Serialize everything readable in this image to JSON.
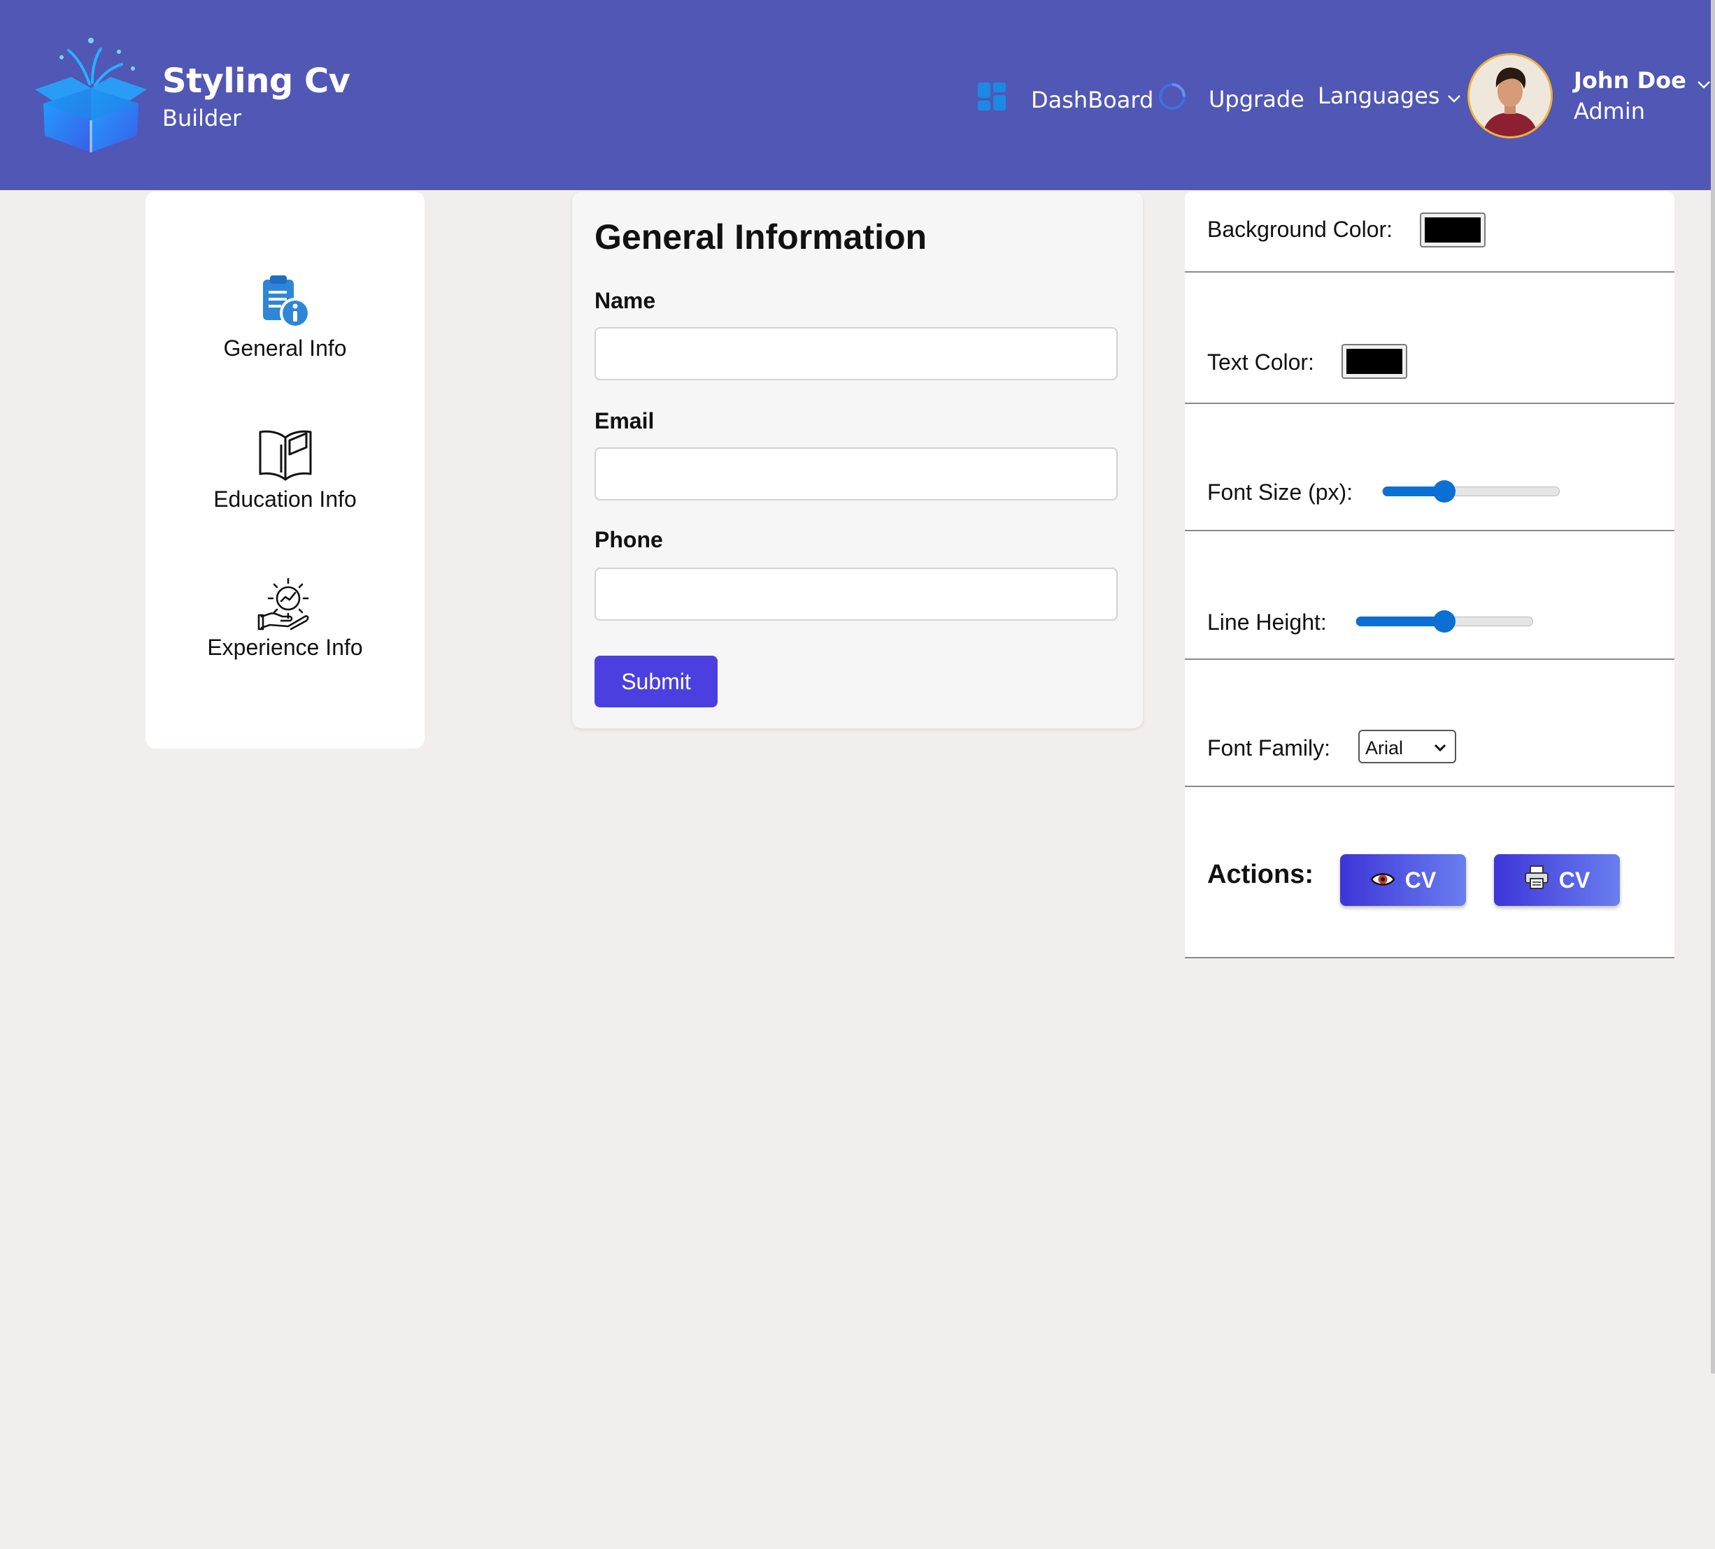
{
  "header": {
    "brand_title": "Styling Cv",
    "brand_subtitle": "Builder",
    "nav": {
      "dashboard_label": "DashBoard",
      "upgrade_label": "Upgrade",
      "languages_label": "Languages"
    },
    "user": {
      "name": "John Doe",
      "role": "Admin"
    }
  },
  "sidebar": {
    "items": [
      {
        "label": "General Info",
        "icon": "clipboard-info-icon"
      },
      {
        "label": "Education Info",
        "icon": "open-book-icon"
      },
      {
        "label": "Experience Info",
        "icon": "gear-hand-icon"
      }
    ]
  },
  "form": {
    "title": "General Information",
    "fields": [
      {
        "label": "Name",
        "value": ""
      },
      {
        "label": "Email",
        "value": ""
      },
      {
        "label": "Phone",
        "value": ""
      }
    ],
    "submit_label": "Submit"
  },
  "style_panel": {
    "background_color_label": "Background Color:",
    "background_color_value": "#000000",
    "text_color_label": "Text Color:",
    "text_color_value": "#000000",
    "font_size_label": "Font Size (px):",
    "font_size_slider_fraction": 0.35,
    "line_height_label": "Line Height:",
    "line_height_slider_fraction": 0.5,
    "font_family_label": "Font Family:",
    "font_family_value": "Arial",
    "actions_label": "Actions:",
    "view_cv_label": "CV",
    "print_cv_label": "CV"
  },
  "colors": {
    "header_bg": "#5057b5",
    "accent": "#4b3fdf",
    "slider": "#0b6fd4",
    "page_bg": "#f1eeed"
  }
}
